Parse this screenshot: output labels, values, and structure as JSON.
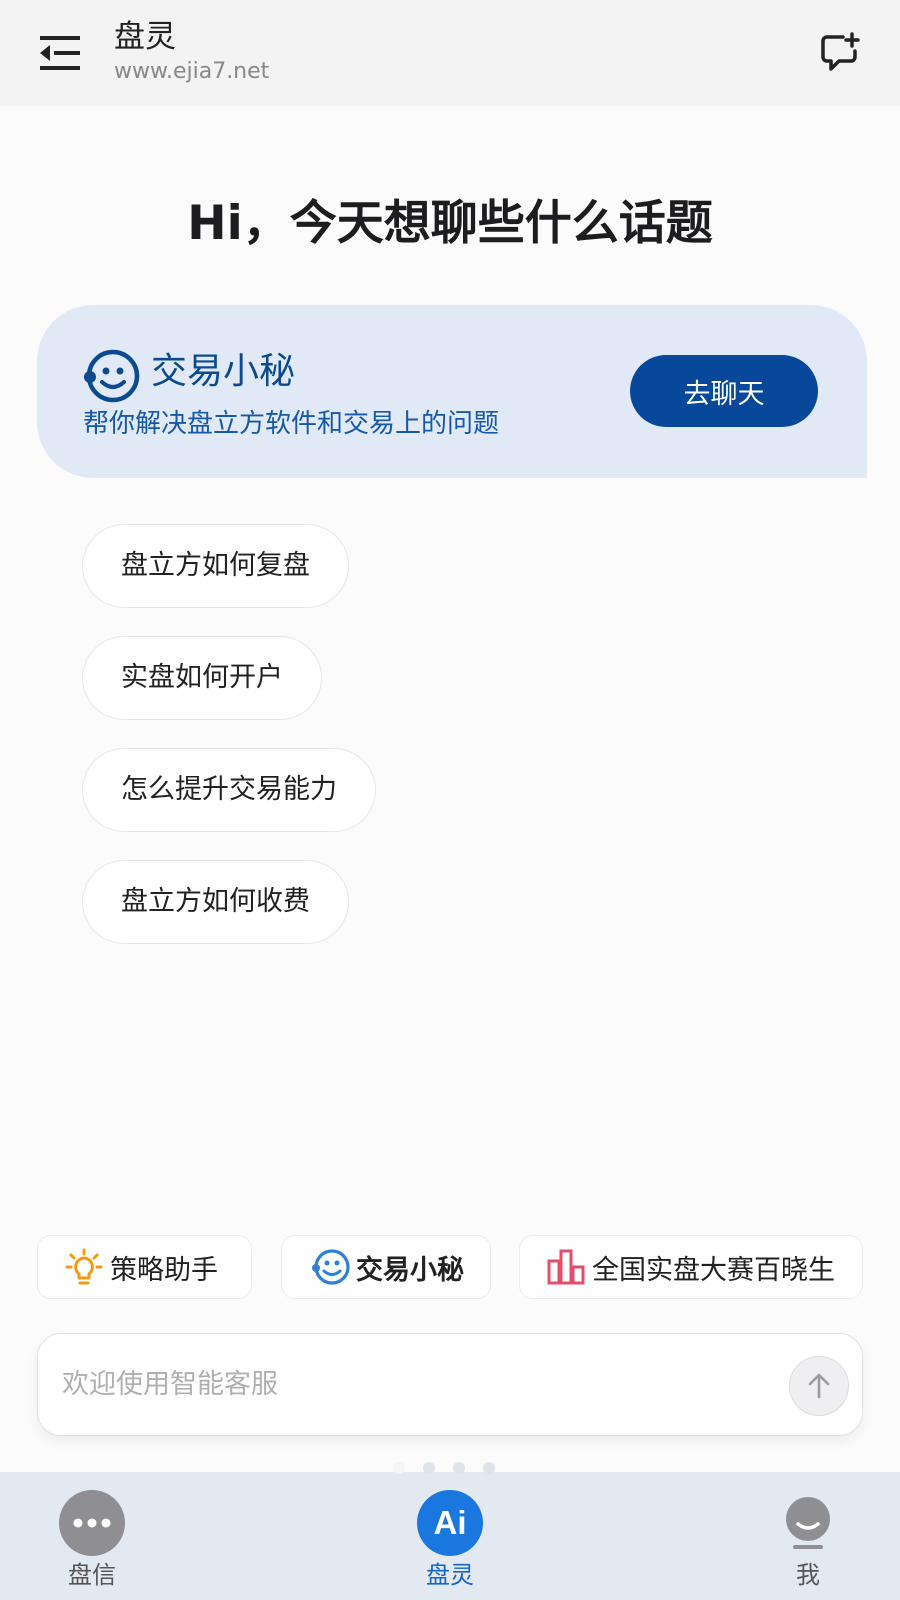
{
  "header": {
    "title": "盘灵",
    "subtitle": "www.ejia7.net",
    "menu_icon": "menu-collapse-icon",
    "new_chat_icon": "chat-add-icon"
  },
  "greeting": "Hi，今天想聊些什么话题",
  "assistant_card": {
    "title": "交易小秘",
    "description": "帮你解决盘立方软件和交易上的问题",
    "button_label": "去聊天",
    "icon": "smiley-bot-icon",
    "accent_color": "#07489a",
    "background_color": "#e0e9f5"
  },
  "suggestions": [
    "盘立方如何复盘",
    "实盘如何开户",
    "怎么提升交易能力",
    "盘立方如何收费"
  ],
  "quick_tools": [
    {
      "label": "策略助手",
      "icon": "lightbulb-icon"
    },
    {
      "label": "交易小秘",
      "icon": "smiley-bot-icon"
    },
    {
      "label": "全国实盘大赛百晓生",
      "icon": "bar-chart-icon"
    }
  ],
  "input": {
    "placeholder": "欢迎使用智能客服",
    "value": "",
    "send_icon": "arrow-up-icon"
  },
  "pager": {
    "total": 4,
    "active_index": 0
  },
  "bottom_nav": {
    "active_index": 1,
    "items": [
      {
        "label": "盘信",
        "icon": "chat-dots-icon"
      },
      {
        "label": "盘灵",
        "icon": "ai-icon",
        "icon_text": "Ai"
      },
      {
        "label": "我",
        "icon": "profile-face-icon"
      }
    ]
  }
}
